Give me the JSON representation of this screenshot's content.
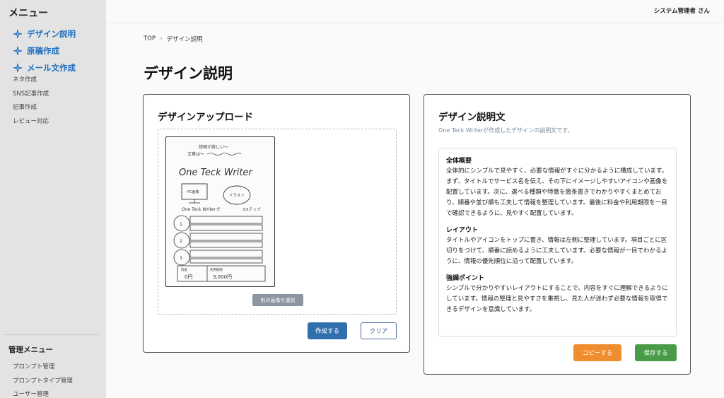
{
  "sidebar": {
    "title": "メニュー",
    "primary_items": [
      {
        "label": "デザイン説明"
      },
      {
        "label": "原稿作成"
      },
      {
        "label": "メール文作成"
      }
    ],
    "secondary_items": [
      {
        "label": "ネタ作成"
      },
      {
        "label": "SNS記事作成"
      },
      {
        "label": "記事作成"
      },
      {
        "label": "レビュー対応"
      }
    ],
    "admin_title": "管理メニュー",
    "admin_items": [
      {
        "label": "プロンプト管理"
      },
      {
        "label": "プロンプトタイプ管理"
      },
      {
        "label": "ユーザー管理"
      }
    ]
  },
  "header": {
    "user_name": "システム管理者 さん"
  },
  "breadcrumb": {
    "home": "TOP",
    "current": "デザイン説明"
  },
  "page": {
    "title": "デザイン説明"
  },
  "upload": {
    "title": "デザインアップロード",
    "reselect_label": "別の画像を選択",
    "create_label": "作成する",
    "clear_label": "クリア",
    "sketch_text": {
      "note1": "説明が欲しい〜",
      "note2": "文章は〜",
      "brand": "One Teck Writer",
      "pc": "PC画像",
      "illust": "イラスト",
      "line": "One Teck Writerで",
      "steps": "3ステップ",
      "step1": "1",
      "step2": "2",
      "step3": "3",
      "price_label": "料金",
      "price": "0円",
      "period_label": "利用期限",
      "period": "3,000円"
    }
  },
  "description": {
    "title": "デザイン説明文",
    "subtitle": "One Teck Writerが作成したデザインの説明文です。",
    "sections": [
      {
        "heading": "全体概要",
        "body": "全体的にシンプルで見やすく、必要な情報がすぐに分かるように構成しています。まず、タイトルでサービス名を伝え、その下にイメージしやすいアイコンや画像を配置しています。次に、選べる種類や特徴を箇条書きでわかりやすくまとめており、順番や並び順も工夫して情報を整理しています。最後に料金や利用期限を一目で確認できるように、見やすく配置しています。"
      },
      {
        "heading": "レイアウト",
        "body": "タイトルやアイコンをトップに置き、情報は左側に整理しています。項目ごとに区切りをつけて、順番に読めるように工夫しています。必要な情報が一目でわかるように、情報の優先順位に沿って配置しています。"
      },
      {
        "heading": "強調ポイント",
        "body": "シンプルで分かりやすいレイアウトにすることで、内容をすぐに理解できるようにしています。情報の整理と見やすさを重視し、見た人が迷わず必要な情報を取得できるデザインを意識しています。"
      }
    ],
    "copy_label": "コピーする",
    "save_label": "保存する"
  },
  "colors": {
    "accent": "#1f6fbf",
    "create_button": "#2f6fae",
    "copy_button": "#ef8d2f",
    "save_button": "#4a9b48"
  }
}
